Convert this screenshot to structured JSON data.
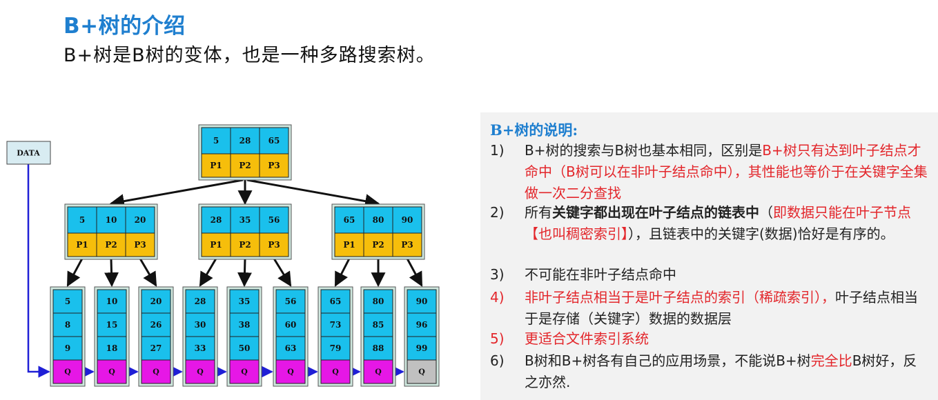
{
  "header": {
    "title": "B+树的介绍",
    "subtitle": "B+树是B树的变体，也是一种多路搜索树。"
  },
  "diagram": {
    "data_label": "DATA",
    "root": {
      "keys": [
        "5",
        "28",
        "65"
      ],
      "pointers": [
        "P1",
        "P2",
        "P3"
      ]
    },
    "internal": [
      {
        "keys": [
          "5",
          "10",
          "20"
        ],
        "pointers": [
          "P1",
          "P2",
          "P3"
        ]
      },
      {
        "keys": [
          "28",
          "35",
          "56"
        ],
        "pointers": [
          "P1",
          "P2",
          "P3"
        ]
      },
      {
        "keys": [
          "65",
          "80",
          "90"
        ],
        "pointers": [
          "P1",
          "P2",
          "P3"
        ]
      }
    ],
    "leaves": [
      {
        "keys": [
          "5",
          "8",
          "9"
        ],
        "q": "Q"
      },
      {
        "keys": [
          "10",
          "15",
          "18"
        ],
        "q": "Q"
      },
      {
        "keys": [
          "20",
          "26",
          "27"
        ],
        "q": "Q"
      },
      {
        "keys": [
          "28",
          "30",
          "33"
        ],
        "q": "Q"
      },
      {
        "keys": [
          "35",
          "38",
          "50"
        ],
        "q": "Q"
      },
      {
        "keys": [
          "56",
          "60",
          "63"
        ],
        "q": "Q"
      },
      {
        "keys": [
          "65",
          "73",
          "79"
        ],
        "q": "Q"
      },
      {
        "keys": [
          "80",
          "85",
          "88"
        ],
        "q": "Q"
      },
      {
        "keys": [
          "90",
          "96",
          "99"
        ],
        "q": "Q"
      }
    ],
    "colors": {
      "key_cell": "#1ac0ec",
      "pointer_cell": "#f6be0b",
      "leaf_q": "#e617e6",
      "last_leaf_q": "#c0c0c0",
      "node_frame": "#cfe8df",
      "link_arrow": "#1f1fd6"
    }
  },
  "panel": {
    "title": "B+树的说明:",
    "items": [
      {
        "num": "1)",
        "parts": [
          {
            "text": "B+树的搜索与B树也基本相同，区别是",
            "style": ""
          },
          {
            "text": "B+树只有达到叶子结点才命中（B树可以在非叶子结点命中），其性能也等价于在关键字全集做一次二分查找",
            "style": "red"
          }
        ]
      },
      {
        "num": "2)",
        "parts": [
          {
            "text": "所有",
            "style": ""
          },
          {
            "text": "关键字都出现在叶子结点的链表中",
            "style": "bold"
          },
          {
            "text": "（",
            "style": ""
          },
          {
            "text": "即数据只能在叶子节点【也叫稠密索引】",
            "style": "red"
          },
          {
            "text": "），且链表中的关键字(数据)恰好是有序的。",
            "style": ""
          }
        ]
      },
      {
        "num": "3)",
        "parts": [
          {
            "text": "不可能在非叶子结点命中",
            "style": ""
          }
        ]
      },
      {
        "num": "4)",
        "num_style": "red",
        "parts": [
          {
            "text": "非叶子结点相当于是叶子结点的索引（稀疏索引），",
            "style": "red"
          },
          {
            "text": "叶子结点相当于是存储（关键字）数据的数据层",
            "style": ""
          }
        ]
      },
      {
        "num": "5)",
        "num_style": "red",
        "parts": [
          {
            "text": "更适合文件索引系统",
            "style": "red"
          }
        ]
      },
      {
        "num": "6)",
        "parts": [
          {
            "text": "B树和B+树各有自己的应用场景，不能说B+树",
            "style": ""
          },
          {
            "text": "完全比",
            "style": "red"
          },
          {
            "text": "B树好，反之亦然.",
            "style": ""
          }
        ]
      }
    ]
  }
}
